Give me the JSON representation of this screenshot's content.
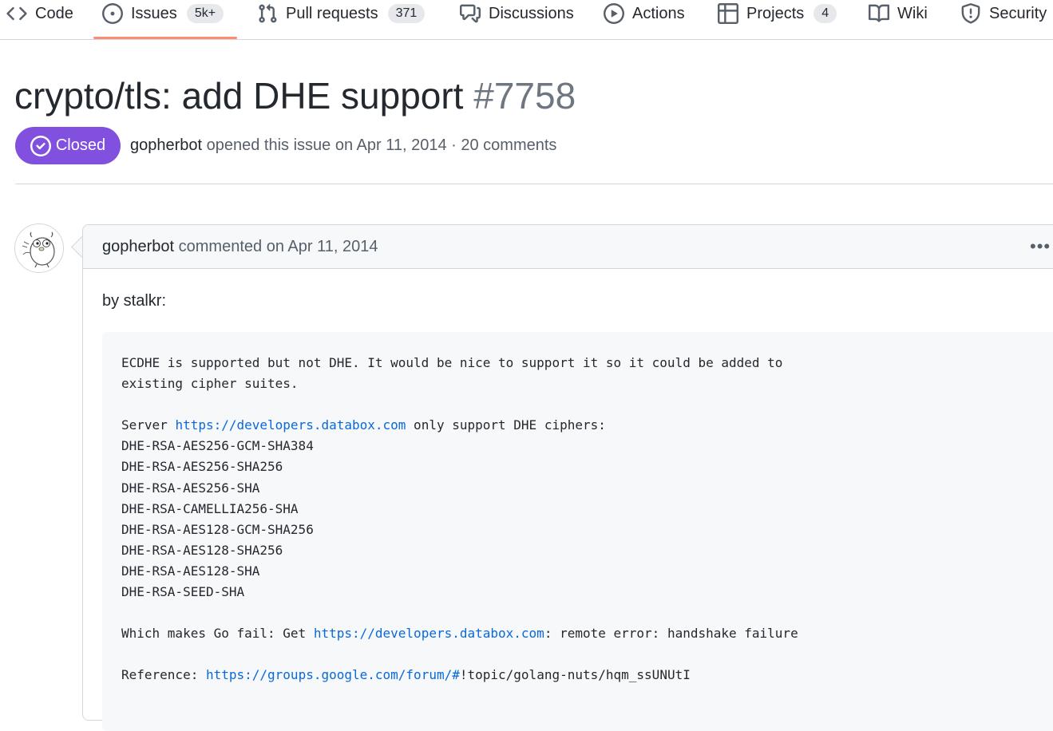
{
  "tabs": [
    {
      "label": "Code",
      "icon": "code-icon"
    },
    {
      "label": "Issues",
      "icon": "issue-opened-icon",
      "counter": "5k+"
    },
    {
      "label": "Pull requests",
      "icon": "git-pull-request-icon",
      "counter": "371"
    },
    {
      "label": "Discussions",
      "icon": "comment-discussion-icon"
    },
    {
      "label": "Actions",
      "icon": "play-icon"
    },
    {
      "label": "Projects",
      "icon": "table-icon",
      "counter": "4"
    },
    {
      "label": "Wiki",
      "icon": "book-icon"
    },
    {
      "label": "Security",
      "icon": "shield-icon"
    }
  ],
  "active_tab": "Issues",
  "issue": {
    "title": "crypto/tls: add DHE support",
    "number": "#7758",
    "state": "Closed",
    "state_color": "#8250df",
    "author": "gopherbot",
    "meta_rest": "opened this issue on Apr 11, 2014 · 20 comments"
  },
  "comment": {
    "author": "gopherbot",
    "action": "commented on Apr 11, 2014",
    "menu": "•••",
    "by_line": "by stalkr:",
    "code_lines": [
      [
        {
          "t": "ECDHE is supported but not DHE. It would be nice to support it so it could be added to"
        }
      ],
      [
        {
          "t": "existing cipher suites."
        }
      ],
      [
        {
          "t": ""
        }
      ],
      [
        {
          "t": "Server "
        },
        {
          "t": "https://developers.databox.com",
          "link": true
        },
        {
          "t": " only support DHE ciphers:"
        }
      ],
      [
        {
          "t": "DHE-RSA-AES256-GCM-SHA384"
        }
      ],
      [
        {
          "t": "DHE-RSA-AES256-SHA256"
        }
      ],
      [
        {
          "t": "DHE-RSA-AES256-SHA"
        }
      ],
      [
        {
          "t": "DHE-RSA-CAMELLIA256-SHA"
        }
      ],
      [
        {
          "t": "DHE-RSA-AES128-GCM-SHA256"
        }
      ],
      [
        {
          "t": "DHE-RSA-AES128-SHA256"
        }
      ],
      [
        {
          "t": "DHE-RSA-AES128-SHA"
        }
      ],
      [
        {
          "t": "DHE-RSA-SEED-SHA"
        }
      ],
      [
        {
          "t": ""
        }
      ],
      [
        {
          "t": "Which makes Go fail: Get "
        },
        {
          "t": "https://developers.databox.com",
          "link": true
        },
        {
          "t": ": remote error: handshake failure"
        }
      ],
      [
        {
          "t": ""
        }
      ],
      [
        {
          "t": "Reference: "
        },
        {
          "t": "https://groups.google.com/forum/#",
          "link": true
        },
        {
          "t": "!topic/golang-nuts/hqm_ssUNUtI"
        }
      ]
    ]
  },
  "colors": {
    "link": "#0969da",
    "active_underline": "#fd8c73",
    "muted": "#57606a"
  }
}
